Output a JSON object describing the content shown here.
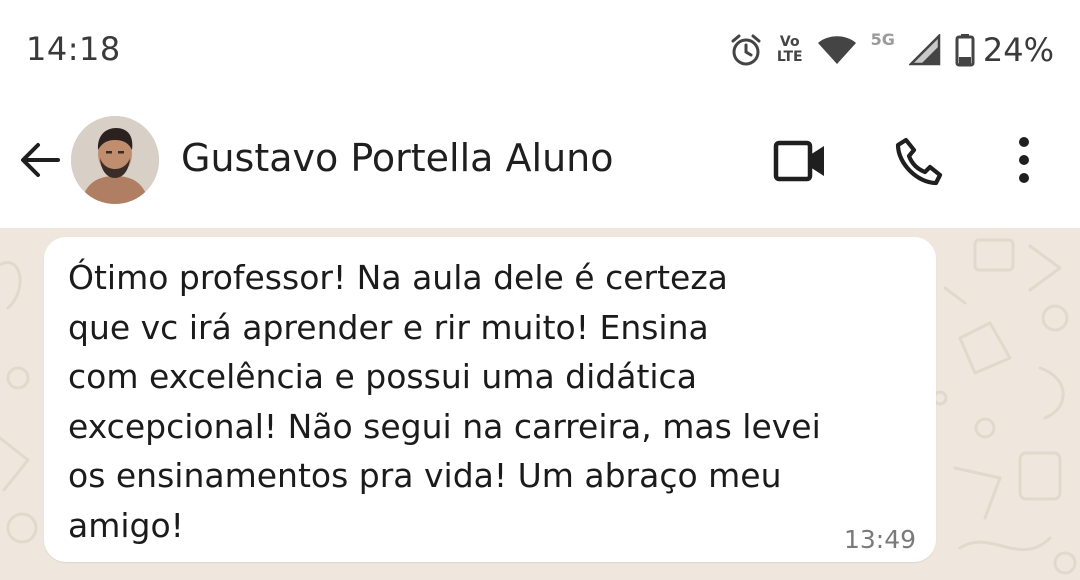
{
  "status_bar": {
    "time": "14:18",
    "battery_percent": "24%",
    "network_5g": "5G",
    "volte_line1": "Vo",
    "volte_line2": "LTE",
    "icons": [
      "alarm-icon",
      "volte-icon",
      "wifi-icon",
      "cellular-signal-icon",
      "battery-icon"
    ]
  },
  "header": {
    "contact_name": "Gustavo Portella Aluno",
    "icons": [
      "back-arrow-icon",
      "video-call-icon",
      "phone-call-icon",
      "more-options-icon"
    ]
  },
  "chat": {
    "messages": [
      {
        "text": "Ótimo professor! Na aula dele é certeza\nque vc irá aprender e rir muito! Ensina\ncom excelência e possui uma didática\nexcepcional! Não segui na carreira, mas levei\nos ensinamentos pra vida! Um abraço meu\namigo!",
        "time": "13:49"
      }
    ]
  },
  "colors": {
    "chat_background": "#efe7dd",
    "bubble": "#ffffff",
    "text": "#1b1b1b",
    "timestamp": "#7a7a7a"
  }
}
